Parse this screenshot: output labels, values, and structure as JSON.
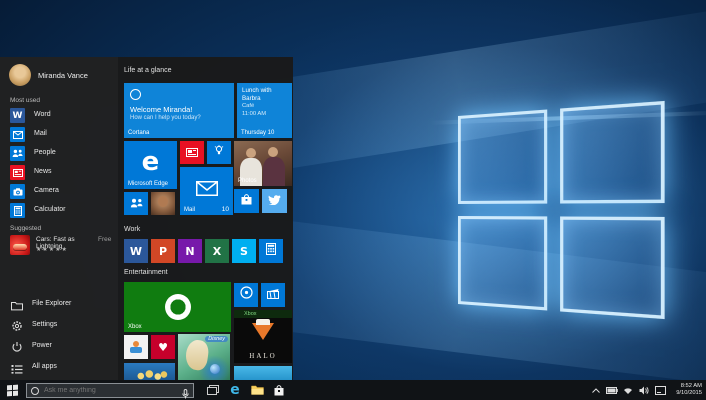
{
  "user": {
    "name": "Miranda Vance"
  },
  "left_rail": {
    "most_used_label": "Most used",
    "most_used": [
      {
        "label": "Word",
        "letter": "W",
        "color": "#2b579a"
      },
      {
        "label": "Mail",
        "color": "#0078d7"
      },
      {
        "label": "People",
        "color": "#0078d7"
      },
      {
        "label": "News",
        "color": "#e81123"
      },
      {
        "label": "Camera",
        "color": "#0078d7"
      },
      {
        "label": "Calculator",
        "color": "#0078d7"
      }
    ],
    "suggested_label": "Suggested",
    "suggested": {
      "title": "Cars: Fast as Lightning",
      "price": "Free",
      "stars": "★★★★★"
    },
    "system_items": [
      {
        "label": "File Explorer"
      },
      {
        "label": "Settings"
      },
      {
        "label": "Power"
      },
      {
        "label": "All apps"
      }
    ]
  },
  "groups": {
    "glance_label": "Life at a glance",
    "work_label": "Work",
    "entertainment_label": "Entertainment"
  },
  "tiles": {
    "cortana": {
      "greeting": "Welcome Miranda!",
      "subtitle": "How can I help you today?",
      "label": "Cortana",
      "color": "#0f84d8"
    },
    "calendar": {
      "title": "Lunch with Barbra",
      "location": "Café",
      "time": "11:00 AM",
      "footer": "Thursday 10",
      "color": "#0f84d8"
    },
    "edge": {
      "label": "Microsoft Edge",
      "letter": "e",
      "color": "#0078d7"
    },
    "news": {
      "color": "#e81123"
    },
    "tips": {
      "color": "#0078d7"
    },
    "photos": {
      "label": "Photos"
    },
    "people": {
      "color": "#0078d7"
    },
    "mail": {
      "label": "Mail",
      "count": "10",
      "color": "#0078d7"
    },
    "store": {
      "color": "#0078d7"
    },
    "twitter": {
      "color": "#55acee"
    },
    "work_tiles": [
      {
        "label": "Word",
        "letter": "W",
        "color": "#2b579a"
      },
      {
        "label": "PowerPoint",
        "letter": "P",
        "color": "#d24726"
      },
      {
        "label": "OneNote",
        "letter": "N",
        "color": "#7719aa"
      },
      {
        "label": "Excel",
        "letter": "X",
        "color": "#217346"
      },
      {
        "label": "Skype",
        "letter": "S",
        "color": "#00aff0"
      },
      {
        "label": "Calculator",
        "color": "#0078d7"
      }
    ],
    "xbox": {
      "label": "Xbox",
      "color": "#107c10"
    },
    "groove": {
      "color": "#0078d7"
    },
    "movies": {
      "color": "#0078d7"
    },
    "halo": {
      "badge": "Xbox",
      "label": "HALO",
      "color": "#0a0a0a"
    },
    "iheart": {
      "glyph": "♥",
      "color": "#c6002b"
    },
    "frozen": {
      "badge": "Disney"
    }
  },
  "taskbar": {
    "search_placeholder": "Ask me anything",
    "clock": {
      "time": "8:52 AM",
      "date": "9/10/2015"
    }
  }
}
